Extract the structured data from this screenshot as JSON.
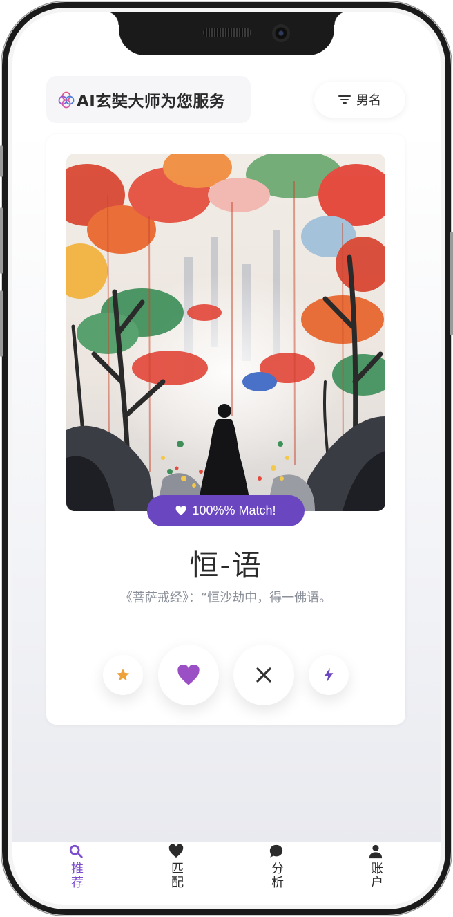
{
  "header": {
    "title": "AI玄奘大师为您服务",
    "filter_label": "男名",
    "logo_icon": "clover-logo-icon",
    "filter_icon": "filter-lines-icon"
  },
  "card": {
    "match_label": "100%% Match!",
    "match_icon": "heart-icon",
    "name": "恒-语",
    "quote": "《菩萨戒经》：“恒沙劫中，得一佛语。",
    "actions": [
      {
        "name": "star",
        "icon": "star-icon",
        "color": "#f0a23a"
      },
      {
        "name": "like",
        "icon": "heart-icon",
        "color": "#9b4fc4"
      },
      {
        "name": "dislike",
        "icon": "close-icon",
        "color": "#333333"
      },
      {
        "name": "boost",
        "icon": "lightning-icon",
        "color": "#6b46c1"
      }
    ]
  },
  "tabs": [
    {
      "label": "推荐",
      "icon": "search-icon",
      "active": true
    },
    {
      "label": "匹配",
      "icon": "heart-icon",
      "active": false
    },
    {
      "label": "分析",
      "icon": "chat-bubble-icon",
      "active": false
    },
    {
      "label": "账户",
      "icon": "user-icon",
      "active": false
    }
  ],
  "colors": {
    "accent": "#6b46c1",
    "active_tab": "#7c4dcc",
    "inactive_tab": "#2b2b2b",
    "text_muted": "#8a8f99"
  }
}
